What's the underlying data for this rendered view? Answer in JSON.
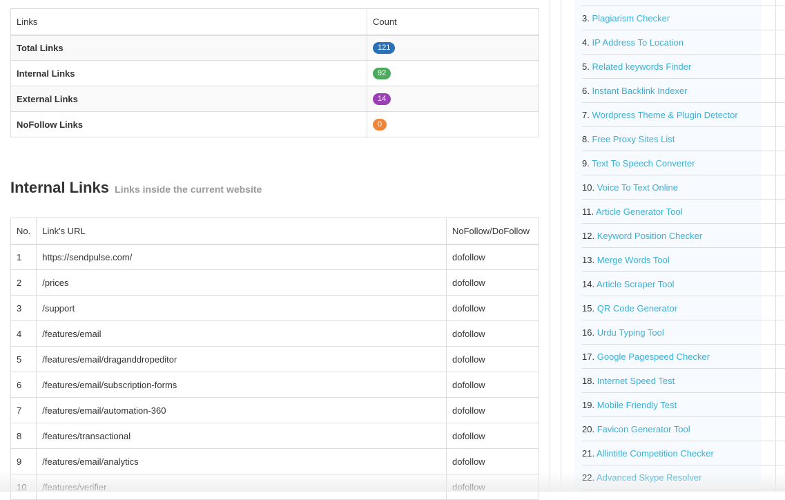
{
  "summary": {
    "headers": [
      "Links",
      "Count"
    ],
    "rows": [
      {
        "label": "Total Links",
        "count": "121",
        "color": "#2a72b5"
      },
      {
        "label": "Internal Links",
        "count": "92",
        "color": "#4caa5c"
      },
      {
        "label": "External Links",
        "count": "14",
        "color": "#9b3fb5"
      },
      {
        "label": "NoFollow Links",
        "count": "0",
        "color": "#f0863a"
      }
    ]
  },
  "internal": {
    "title": "Internal Links",
    "subtitle": "Links inside the current website",
    "headers": [
      "No.",
      "Link's URL",
      "NoFollow/DoFollow"
    ],
    "rows": [
      [
        "1",
        "https://sendpulse.com/",
        "dofollow"
      ],
      [
        "2",
        "/prices",
        "dofollow"
      ],
      [
        "3",
        "/support",
        "dofollow"
      ],
      [
        "4",
        "/features/email",
        "dofollow"
      ],
      [
        "5",
        "/features/email/draganddropeditor",
        "dofollow"
      ],
      [
        "6",
        "/features/email/subscription-forms",
        "dofollow"
      ],
      [
        "7",
        "/features/email/automation-360",
        "dofollow"
      ],
      [
        "8",
        "/features/transactional",
        "dofollow"
      ],
      [
        "9",
        "/features/email/analytics",
        "dofollow"
      ],
      [
        "10",
        "/features/verifier",
        "dofollow"
      ]
    ]
  },
  "sidebar": {
    "items": [
      {
        "n": "3.",
        "label": "Plagiarism Checker"
      },
      {
        "n": "4.",
        "label": "IP Address To Location"
      },
      {
        "n": "5.",
        "label": "Related keywords Finder"
      },
      {
        "n": "6.",
        "label": "Instant Backlink Indexer"
      },
      {
        "n": "7.",
        "label": "Wordpress Theme & Plugin Detector"
      },
      {
        "n": "8.",
        "label": "Free Proxy Sites List"
      },
      {
        "n": "9.",
        "label": "Text To Speech Converter"
      },
      {
        "n": "10.",
        "label": "Voice To Text Online"
      },
      {
        "n": "11.",
        "label": "Article Generator Tool"
      },
      {
        "n": "12.",
        "label": "Keyword Position Checker"
      },
      {
        "n": "13.",
        "label": "Merge Words Tool"
      },
      {
        "n": "14.",
        "label": "Article Scraper Tool"
      },
      {
        "n": "15.",
        "label": "QR Code Generator"
      },
      {
        "n": "16.",
        "label": "Urdu Typing Tool"
      },
      {
        "n": "17.",
        "label": "Google Pagespeed Checker"
      },
      {
        "n": "18.",
        "label": "Internet Speed Test"
      },
      {
        "n": "19.",
        "label": "Mobile Friendly Test"
      },
      {
        "n": "20.",
        "label": "Favicon Generator Tool"
      },
      {
        "n": "21.",
        "label": "Allintitle Competition Checker"
      },
      {
        "n": "22.",
        "label": "Advanced Skype Resolver"
      }
    ]
  }
}
